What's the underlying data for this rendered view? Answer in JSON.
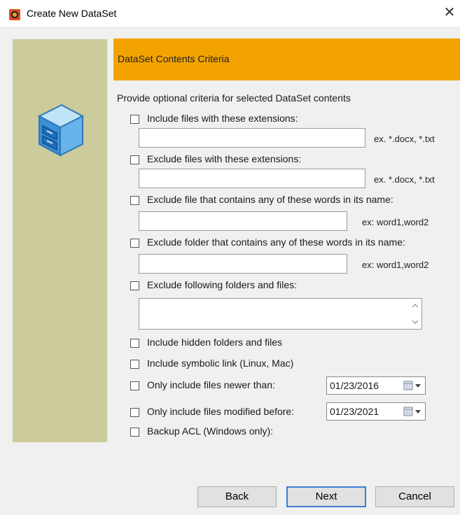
{
  "window": {
    "title": "Create New DataSet"
  },
  "header": {
    "title": "DataSet Contents Criteria"
  },
  "intro": "Provide optional criteria for selected DataSet contents",
  "options": {
    "include_ext": {
      "label": "Include files with these extensions:",
      "value": "",
      "hint": "ex. *.docx, *.txt"
    },
    "exclude_ext": {
      "label": "Exclude files with these extensions:",
      "value": "",
      "hint": "ex. *.docx, *.txt"
    },
    "exclude_file_words": {
      "label": "Exclude file that contains any of these words in its name:",
      "value": "",
      "hint": "ex: word1,word2"
    },
    "exclude_folder_words": {
      "label": "Exclude folder that contains any of these words in its name:",
      "value": "",
      "hint": "ex: word1,word2"
    },
    "exclude_following": {
      "label": "Exclude following folders and files:",
      "value": ""
    },
    "include_hidden": {
      "label": "Include hidden folders and files"
    },
    "include_symlink": {
      "label": "Include symbolic link (Linux, Mac)"
    },
    "newer_than": {
      "label": "Only include files newer than:",
      "date": "01/23/2016"
    },
    "modified_before": {
      "label": "Only include files modified before:",
      "date": "01/23/2021"
    },
    "backup_acl": {
      "label": "Backup ACL (Windows only):"
    }
  },
  "buttons": {
    "back": "Back",
    "next": "Next",
    "cancel": "Cancel"
  },
  "colors": {
    "accent": "#f3a300",
    "side_panel": "#cbcb9c",
    "default_button_border": "#3d7fd4"
  },
  "icons": [
    "app-icon",
    "close-icon",
    "database-cabinet-icon",
    "calendar-dropdown-icon"
  ]
}
